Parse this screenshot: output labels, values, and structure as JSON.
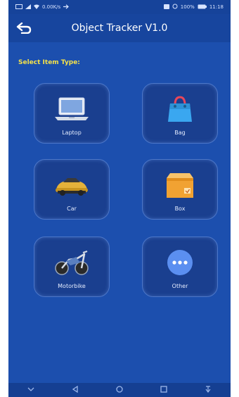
{
  "status_bar": {
    "left_text": "0.00K/s",
    "battery": "100%",
    "time": "11:18"
  },
  "app_bar": {
    "title": "Object Tracker V1.0",
    "back_icon": "back-arrow-icon"
  },
  "section": {
    "label": "Select  Item Type:"
  },
  "items": [
    {
      "label": "Laptop",
      "icon": "laptop-icon"
    },
    {
      "label": "Bag",
      "icon": "bag-icon"
    },
    {
      "label": "Car",
      "icon": "car-icon"
    },
    {
      "label": "Box",
      "icon": "box-icon"
    },
    {
      "label": "Motorbike",
      "icon": "motorbike-icon"
    },
    {
      "label": "Other",
      "icon": "chat-bubble-icon"
    }
  ],
  "colors": {
    "background": "#1c4fae",
    "accent_label": "#f4e14a",
    "tile_border": "#4d77c8"
  }
}
